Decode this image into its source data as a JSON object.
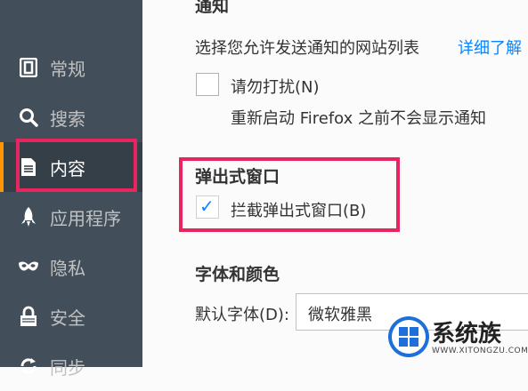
{
  "sidebar": {
    "items": [
      {
        "label": "常规",
        "icon": "general-icon"
      },
      {
        "label": "搜索",
        "icon": "search-icon"
      },
      {
        "label": "内容",
        "icon": "content-icon",
        "selected": true
      },
      {
        "label": "应用程序",
        "icon": "applications-icon"
      },
      {
        "label": "隐私",
        "icon": "privacy-mask-icon"
      },
      {
        "label": "安全",
        "icon": "security-lock-icon"
      },
      {
        "label": "同步",
        "icon": "sync-icon"
      }
    ]
  },
  "notifications": {
    "title": "通知",
    "description": "选择您允许发送通知的网站列表",
    "learn_more": "详细了解",
    "dnd_label": "请勿打扰(N)",
    "dnd_checked": false,
    "restart_note": "重新启动 Firefox 之前不会显示通知"
  },
  "popups": {
    "title": "弹出式窗口",
    "block_label": "拦截弹出式窗口(B)",
    "block_checked": true,
    "checkmark": "✓"
  },
  "fonts": {
    "title": "字体和颜色",
    "default_font_label": "默认字体(D):",
    "default_font_value": "微软雅黑"
  },
  "watermark": {
    "brand": "系统族",
    "url": "WWW.XITONGZU.COM"
  },
  "colors": {
    "sidebar_bg": "#424f5a",
    "selected_accent": "#ff9500",
    "highlight": "#e8255e",
    "link": "#0a84ff"
  }
}
